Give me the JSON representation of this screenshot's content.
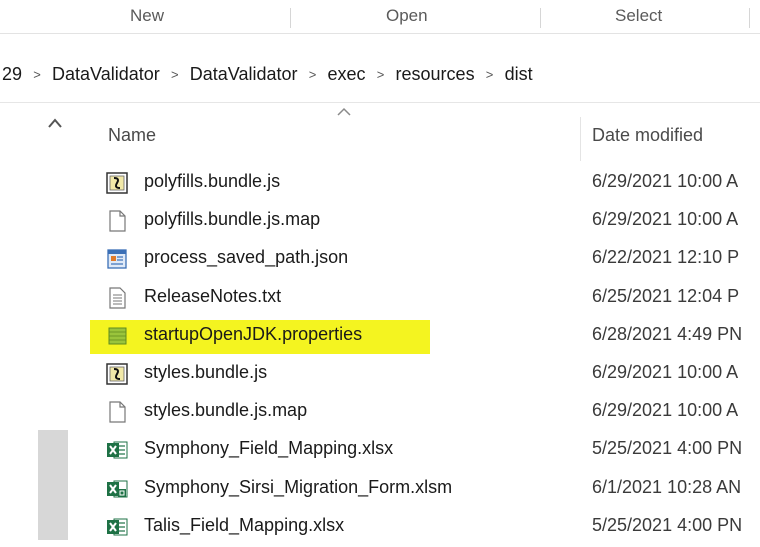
{
  "ribbon": {
    "groups": [
      {
        "label": "New"
      },
      {
        "label": "Open"
      },
      {
        "label": "Select"
      }
    ]
  },
  "address": {
    "crumbs": [
      "29",
      "DataValidator",
      "DataValidator",
      "exec",
      "resources",
      "dist"
    ],
    "separator": ">"
  },
  "columns": {
    "name": "Name",
    "date": "Date modified"
  },
  "files": [
    {
      "name": "polyfills.bundle.js",
      "date": "6/29/2021 10:00 A",
      "icon": "script-icon"
    },
    {
      "name": "polyfills.bundle.js.map",
      "date": "6/29/2021 10:00 A",
      "icon": "blank-file-icon"
    },
    {
      "name": "process_saved_path.json",
      "date": "6/22/2021 12:10 P",
      "icon": "json-file-icon"
    },
    {
      "name": "ReleaseNotes.txt",
      "date": "6/25/2021 12:04 P",
      "icon": "text-file-icon"
    },
    {
      "name": "startupOpenJDK.properties",
      "date": "6/28/2021 4:49 PN",
      "icon": "properties-file-icon",
      "highlighted": true
    },
    {
      "name": "styles.bundle.js",
      "date": "6/29/2021 10:00 A",
      "icon": "script-icon"
    },
    {
      "name": "styles.bundle.js.map",
      "date": "6/29/2021 10:00 A",
      "icon": "blank-file-icon"
    },
    {
      "name": "Symphony_Field_Mapping.xlsx",
      "date": "5/25/2021 4:00 PN",
      "icon": "excel-icon"
    },
    {
      "name": "Symphony_Sirsi_Migration_Form.xlsm",
      "date": "6/1/2021 10:28 AN",
      "icon": "excel-macro-icon"
    },
    {
      "name": "Talis_Field_Mapping.xlsx",
      "date": "5/25/2021 4:00 PN",
      "icon": "excel-icon"
    }
  ],
  "colors": {
    "highlight": "#f4f420",
    "excel_green": "#1e7145",
    "properties_green": "#8fbf3a"
  }
}
